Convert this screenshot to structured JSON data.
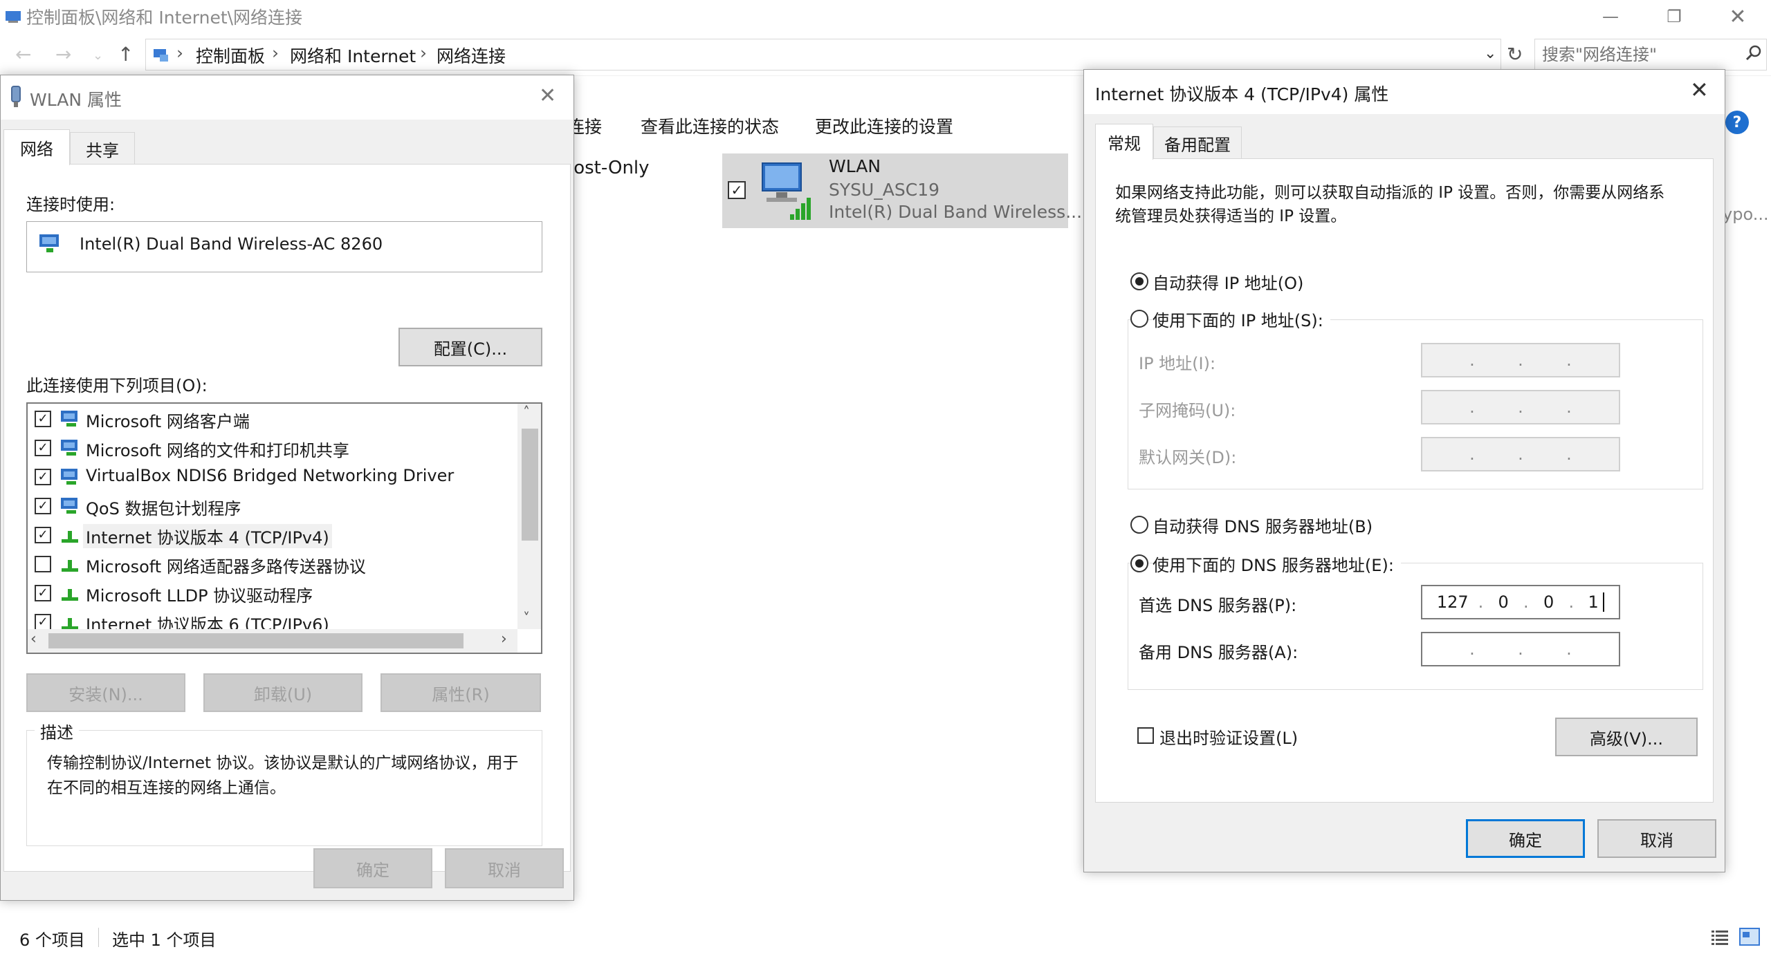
{
  "explorer": {
    "title": "控制面板\\网络和 Internet\\网络连接",
    "breadcrumb": [
      "控制面板",
      "网络和 Internet",
      "网络连接"
    ],
    "search_placeholder": "搜索\"网络连接\"",
    "commands": [
      "连接",
      "查看此连接的状态",
      "更改此连接的设置"
    ],
    "left_item_partial": "lost-Only",
    "right_item_partial": "ypo...",
    "wlan_item": {
      "name": "WLAN",
      "ssid": "SYSU_ASC19",
      "adapter": "Intel(R) Dual Band Wireless..."
    },
    "status": {
      "count": "6 个项目",
      "selected": "选中 1 个项目"
    }
  },
  "wlan_dialog": {
    "title": "WLAN 属性",
    "tabs": [
      "网络",
      "共享"
    ],
    "connect_using_label": "连接时使用:",
    "adapter": "Intel(R) Dual Band Wireless-AC 8260",
    "configure_btn": "配置(C)...",
    "items_label": "此连接使用下列项目(O):",
    "items": [
      {
        "label": "Microsoft 网络客户端",
        "checked": "true"
      },
      {
        "label": "Microsoft 网络的文件和打印机共享",
        "checked": "true"
      },
      {
        "label": "VirtualBox NDIS6 Bridged Networking Driver",
        "checked": "true"
      },
      {
        "label": "QoS 数据包计划程序",
        "checked": "true"
      },
      {
        "label": "Internet 协议版本 4 (TCP/IPv4)",
        "checked": "true"
      },
      {
        "label": "Microsoft 网络适配器多路传送器协议",
        "checked": "false"
      },
      {
        "label": "Microsoft LLDP 协议驱动程序",
        "checked": "true"
      },
      {
        "label": "Internet 协议版本 6 (TCP/IPv6)",
        "checked": "true"
      }
    ],
    "install_btn": "安装(N)...",
    "uninstall_btn": "卸载(U)",
    "properties_btn": "属性(R)",
    "description_label": "描述",
    "description": "传输控制协议/Internet 协议。该协议是默认的广域网络协议，用于在不同的相互连接的网络上通信。",
    "ok_btn": "确定",
    "cancel_btn": "取消"
  },
  "ipv4_dialog": {
    "title": "Internet 协议版本 4 (TCP/IPv4) 属性",
    "tabs": [
      "常规",
      "备用配置"
    ],
    "intro": "如果网络支持此功能，则可以获取自动指派的 IP 设置。否则，你需要从网络系统管理员处获得适当的 IP 设置。",
    "auto_ip": "自动获得 IP 地址(O)",
    "manual_ip": "使用下面的 IP 地址(S):",
    "ip_label": "IP 地址(I):",
    "mask_label": "子网掩码(U):",
    "gateway_label": "默认网关(D):",
    "auto_dns": "自动获得 DNS 服务器地址(B)",
    "manual_dns": "使用下面的 DNS 服务器地址(E):",
    "preferred_dns_label": "首选 DNS 服务器(P):",
    "preferred_dns": [
      "127",
      "0",
      "0",
      "1"
    ],
    "alternate_dns_label": "备用 DNS 服务器(A):",
    "validate_label": "退出时验证设置(L)",
    "advanced_btn": "高级(V)...",
    "ok_btn": "确定",
    "cancel_btn": "取消"
  }
}
